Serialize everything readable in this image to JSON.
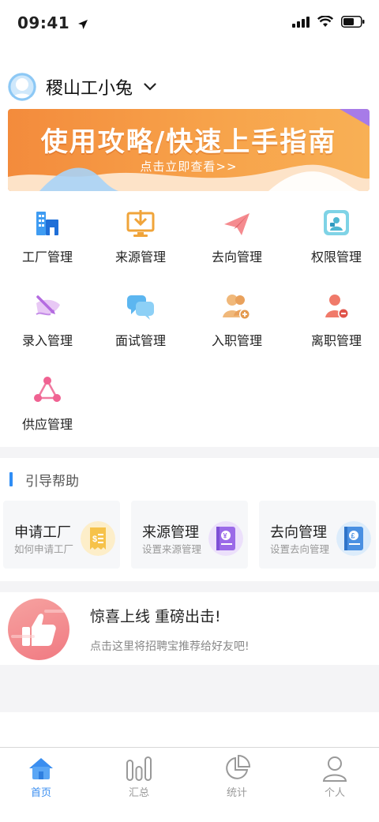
{
  "status_bar": {
    "time": "09:41"
  },
  "header": {
    "company_name": "稷山工小兔"
  },
  "banner": {
    "title": "使用攻略/快速上手指南",
    "subtitle": "点击立即查看>>"
  },
  "menu": [
    {
      "label": "工厂管理",
      "icon": "factory-icon"
    },
    {
      "label": "来源管理",
      "icon": "download-screen-icon"
    },
    {
      "label": "去向管理",
      "icon": "paper-plane-icon"
    },
    {
      "label": "权限管理",
      "icon": "permission-icon"
    },
    {
      "label": "录入管理",
      "icon": "pen-entry-icon"
    },
    {
      "label": "面试管理",
      "icon": "chat-bubbles-icon"
    },
    {
      "label": "入职管理",
      "icon": "add-user-icon"
    },
    {
      "label": "离职管理",
      "icon": "remove-user-icon"
    },
    {
      "label": "供应管理",
      "icon": "network-icon"
    }
  ],
  "guide": {
    "title": "引导帮助",
    "cards": [
      {
        "title": "申请工厂",
        "subtitle": "如何申请工厂",
        "icon": "receipt-icon"
      },
      {
        "title": "来源管理",
        "subtitle": "设置来源管理",
        "icon": "yen-book-icon"
      },
      {
        "title": "去向管理",
        "subtitle": "设置去向管理",
        "icon": "pound-book-icon"
      }
    ]
  },
  "promo": {
    "title": "惊喜上线  重磅出击!",
    "subtitle": "点击这里将招聘宝推荐给好友吧!"
  },
  "tabbar": [
    {
      "label": "首页",
      "icon": "home-icon",
      "active": true
    },
    {
      "label": "汇总",
      "icon": "bars-icon",
      "active": false
    },
    {
      "label": "统计",
      "icon": "pie-chart-icon",
      "active": false
    },
    {
      "label": "个人",
      "icon": "person-icon",
      "active": false
    }
  ],
  "colors": {
    "accent": "#3a8ef0",
    "banner": "#f7a24a",
    "section_bg": "#f4f4f6"
  }
}
